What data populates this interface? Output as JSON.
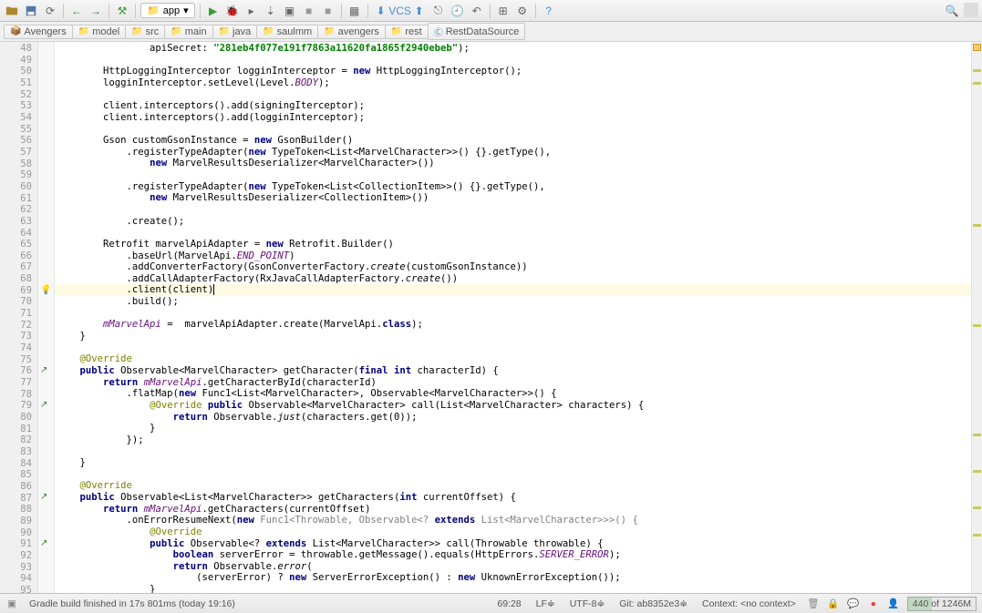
{
  "toolbar": {
    "run_config": "app",
    "icons": [
      "open",
      "save",
      "back",
      "forward",
      "hammer",
      "play",
      "debug",
      "run-cursor",
      "stop",
      "stop2",
      "attach",
      "cov",
      "sync",
      "vcs-up",
      "vcs-down",
      "vcs-commit",
      "changes",
      "history",
      "revert",
      "window",
      "settings",
      "help",
      "search",
      "avatar"
    ]
  },
  "breadcrumbs": [
    {
      "icon": "📦",
      "label": "Avengers"
    },
    {
      "icon": "📁",
      "label": "model"
    },
    {
      "icon": "📁",
      "label": "src"
    },
    {
      "icon": "📁",
      "label": "main"
    },
    {
      "icon": "📁",
      "label": "java"
    },
    {
      "icon": "📁",
      "label": "saulmm"
    },
    {
      "icon": "📁",
      "label": "avengers"
    },
    {
      "icon": "📁",
      "label": "rest"
    },
    {
      "icon": "Ⓒ",
      "label": "RestDataSource"
    }
  ],
  "gutter_start": 48,
  "gutter_end": 95,
  "code": [
    {
      "indent": 16,
      "parts": [
        {
          "t": "apiSecret: ",
          "c": ""
        },
        {
          "t": "\"281eb4f077e191f7863a11620fa1865f2940ebeb\"",
          "c": "str"
        },
        {
          "t": ");",
          "c": ""
        }
      ]
    },
    {
      "indent": 0,
      "parts": []
    },
    {
      "indent": 8,
      "parts": [
        {
          "t": "HttpLoggingInterceptor logginInterceptor = ",
          "c": ""
        },
        {
          "t": "new",
          "c": "kw"
        },
        {
          "t": " HttpLoggingInterceptor();",
          "c": ""
        }
      ]
    },
    {
      "indent": 8,
      "parts": [
        {
          "t": "logginInterceptor.setLevel(Level.",
          "c": ""
        },
        {
          "t": "BODY",
          "c": "field"
        },
        {
          "t": ");",
          "c": ""
        }
      ]
    },
    {
      "indent": 0,
      "parts": []
    },
    {
      "indent": 8,
      "parts": [
        {
          "t": "client.interceptors().add(signingIterceptor);",
          "c": ""
        }
      ]
    },
    {
      "indent": 8,
      "parts": [
        {
          "t": "client.interceptors().add(logginInterceptor);",
          "c": ""
        }
      ]
    },
    {
      "indent": 0,
      "parts": []
    },
    {
      "indent": 8,
      "parts": [
        {
          "t": "Gson customGsonInstance = ",
          "c": ""
        },
        {
          "t": "new",
          "c": "kw"
        },
        {
          "t": " GsonBuilder()",
          "c": ""
        }
      ]
    },
    {
      "indent": 12,
      "parts": [
        {
          "t": ".registerTypeAdapter(",
          "c": ""
        },
        {
          "t": "new",
          "c": "kw"
        },
        {
          "t": " TypeToken<List<MarvelCharacter>>() {}.getType(),",
          "c": ""
        }
      ]
    },
    {
      "indent": 16,
      "parts": [
        {
          "t": "new",
          "c": "kw"
        },
        {
          "t": " MarvelResultsDeserializer<MarvelCharacter>())",
          "c": ""
        }
      ]
    },
    {
      "indent": 0,
      "parts": []
    },
    {
      "indent": 12,
      "parts": [
        {
          "t": ".registerTypeAdapter(",
          "c": ""
        },
        {
          "t": "new",
          "c": "kw"
        },
        {
          "t": " TypeToken<List<CollectionItem>>() {}.getType(),",
          "c": ""
        }
      ]
    },
    {
      "indent": 16,
      "parts": [
        {
          "t": "new",
          "c": "kw"
        },
        {
          "t": " MarvelResultsDeserializer<CollectionItem>())",
          "c": ""
        }
      ]
    },
    {
      "indent": 0,
      "parts": []
    },
    {
      "indent": 12,
      "parts": [
        {
          "t": ".create();",
          "c": ""
        }
      ]
    },
    {
      "indent": 0,
      "parts": []
    },
    {
      "indent": 8,
      "parts": [
        {
          "t": "Retrofit marvelApiAdapter = ",
          "c": ""
        },
        {
          "t": "new",
          "c": "kw"
        },
        {
          "t": " Retrofit.Builder()",
          "c": ""
        }
      ]
    },
    {
      "indent": 12,
      "parts": [
        {
          "t": ".baseUrl(MarvelApi.",
          "c": ""
        },
        {
          "t": "END_POINT",
          "c": "field"
        },
        {
          "t": ")",
          "c": ""
        }
      ]
    },
    {
      "indent": 12,
      "parts": [
        {
          "t": ".addConverterFactory(GsonConverterFactory.",
          "c": ""
        },
        {
          "t": "create",
          "c": "static"
        },
        {
          "t": "(customGsonInstance))",
          "c": ""
        }
      ]
    },
    {
      "indent": 12,
      "parts": [
        {
          "t": ".addCallAdapterFactory(RxJavaCallAdapterFactory.",
          "c": ""
        },
        {
          "t": "create",
          "c": "static"
        },
        {
          "t": "())",
          "c": ""
        }
      ]
    },
    {
      "indent": 12,
      "hl": true,
      "caret": true,
      "parts": [
        {
          "t": ".client(client)",
          "c": ""
        }
      ]
    },
    {
      "indent": 12,
      "parts": [
        {
          "t": ".build();",
          "c": ""
        }
      ]
    },
    {
      "indent": 0,
      "parts": []
    },
    {
      "indent": 8,
      "parts": [
        {
          "t": "mMarvelApi",
          "c": "field"
        },
        {
          "t": " =  marvelApiAdapter.create(MarvelApi.",
          "c": ""
        },
        {
          "t": "class",
          "c": "kw"
        },
        {
          "t": ");",
          "c": ""
        }
      ]
    },
    {
      "indent": 4,
      "parts": [
        {
          "t": "}",
          "c": ""
        }
      ]
    },
    {
      "indent": 0,
      "parts": []
    },
    {
      "indent": 4,
      "parts": [
        {
          "t": "@Override",
          "c": "ann"
        }
      ]
    },
    {
      "indent": 4,
      "parts": [
        {
          "t": "public",
          "c": "kw"
        },
        {
          "t": " Observable<MarvelCharacter> getCharacter(",
          "c": ""
        },
        {
          "t": "final int",
          "c": "kw"
        },
        {
          "t": " characterId) {",
          "c": ""
        }
      ]
    },
    {
      "indent": 8,
      "parts": [
        {
          "t": "return",
          "c": "kw"
        },
        {
          "t": " ",
          "c": ""
        },
        {
          "t": "mMarvelApi",
          "c": "field"
        },
        {
          "t": ".getCharacterById(characterId)",
          "c": ""
        }
      ]
    },
    {
      "indent": 12,
      "parts": [
        {
          "t": ".flatMap(",
          "c": ""
        },
        {
          "t": "new",
          "c": "kw"
        },
        {
          "t": " Func1<List<MarvelCharacter>, Observable<MarvelCharacter>>() {",
          "c": ""
        }
      ]
    },
    {
      "indent": 16,
      "parts": [
        {
          "t": "@Override",
          "c": "ann"
        },
        {
          "t": " ",
          "c": ""
        },
        {
          "t": "public",
          "c": "kw"
        },
        {
          "t": " Observable<MarvelCharacter> call(List<MarvelCharacter> characters) {",
          "c": ""
        }
      ]
    },
    {
      "indent": 20,
      "parts": [
        {
          "t": "return",
          "c": "kw"
        },
        {
          "t": " Observable.",
          "c": ""
        },
        {
          "t": "just",
          "c": "static"
        },
        {
          "t": "(characters.get(0));",
          "c": ""
        }
      ]
    },
    {
      "indent": 16,
      "parts": [
        {
          "t": "}",
          "c": ""
        }
      ]
    },
    {
      "indent": 12,
      "parts": [
        {
          "t": "});",
          "c": ""
        }
      ]
    },
    {
      "indent": 0,
      "parts": []
    },
    {
      "indent": 4,
      "parts": [
        {
          "t": "}",
          "c": ""
        }
      ]
    },
    {
      "indent": 0,
      "parts": []
    },
    {
      "indent": 4,
      "parts": [
        {
          "t": "@Override",
          "c": "ann"
        }
      ]
    },
    {
      "indent": 4,
      "parts": [
        {
          "t": "public",
          "c": "kw"
        },
        {
          "t": " Observable<List<MarvelCharacter>> getCharacters(",
          "c": ""
        },
        {
          "t": "int",
          "c": "kw"
        },
        {
          "t": " currentOffset) {",
          "c": ""
        }
      ]
    },
    {
      "indent": 8,
      "parts": [
        {
          "t": "return",
          "c": "kw"
        },
        {
          "t": " ",
          "c": ""
        },
        {
          "t": "mMarvelApi",
          "c": "field"
        },
        {
          "t": ".getCharacters(currentOffset)",
          "c": ""
        }
      ]
    },
    {
      "indent": 12,
      "parts": [
        {
          "t": ".onErrorResumeNext(",
          "c": ""
        },
        {
          "t": "new",
          "c": "kw"
        },
        {
          "t": " Func1<Throwable, Observable<? ",
          "c": "gray"
        },
        {
          "t": "extends",
          "c": "kw"
        },
        {
          "t": " List<MarvelCharacter>>>() {",
          "c": "gray"
        }
      ]
    },
    {
      "indent": 16,
      "parts": [
        {
          "t": "@Override",
          "c": "ann"
        }
      ]
    },
    {
      "indent": 16,
      "parts": [
        {
          "t": "public",
          "c": "kw"
        },
        {
          "t": " Observable<? ",
          "c": ""
        },
        {
          "t": "extends",
          "c": "kw"
        },
        {
          "t": " List<MarvelCharacter>> call(Throwable throwable) {",
          "c": ""
        }
      ]
    },
    {
      "indent": 20,
      "parts": [
        {
          "t": "boolean",
          "c": "kw"
        },
        {
          "t": " serverError = throwable.getMessage().equals(HttpErrors.",
          "c": ""
        },
        {
          "t": "SERVER_ERROR",
          "c": "field"
        },
        {
          "t": ");",
          "c": ""
        }
      ]
    },
    {
      "indent": 20,
      "parts": [
        {
          "t": "return",
          "c": "kw"
        },
        {
          "t": " Observable.",
          "c": ""
        },
        {
          "t": "error",
          "c": "static"
        },
        {
          "t": "(",
          "c": ""
        }
      ]
    },
    {
      "indent": 24,
      "parts": [
        {
          "t": "(serverError) ? ",
          "c": ""
        },
        {
          "t": "new",
          "c": "kw"
        },
        {
          "t": " ServerErrorException() : ",
          "c": ""
        },
        {
          "t": "new",
          "c": "kw"
        },
        {
          "t": " UknownErrorException());",
          "c": ""
        }
      ]
    },
    {
      "indent": 16,
      "parts": [
        {
          "t": "}",
          "c": ""
        }
      ]
    }
  ],
  "statusbar": {
    "left": "Gradle build finished in 17s 801ms (today 19:16)",
    "pos": "69:28",
    "lf": "LF≑",
    "enc": "UTF-8≑",
    "git": "Git: ab8352e3≑",
    "context": "Context: <no context>",
    "mem": "440 of 1246M"
  }
}
